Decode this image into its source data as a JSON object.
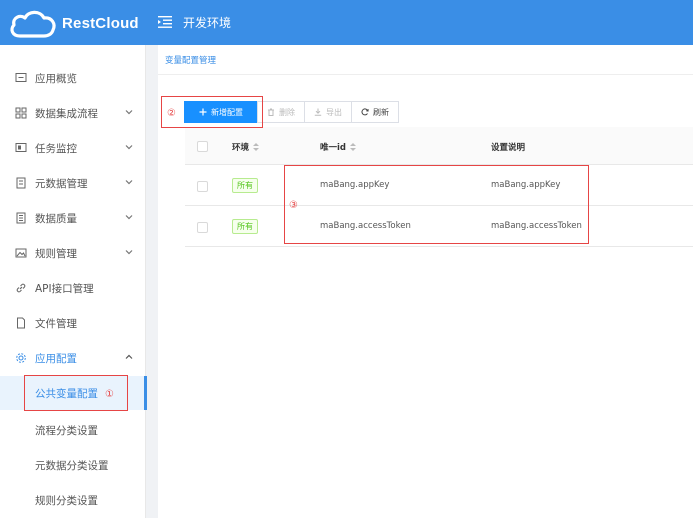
{
  "header": {
    "brand": "RestCloud",
    "env_title": "开发环境"
  },
  "sidebar": {
    "items": [
      {
        "label": "应用概览",
        "icon": "monitor-icon",
        "has_arrow": false
      },
      {
        "label": "数据集成流程",
        "icon": "grid-icon",
        "has_arrow": true
      },
      {
        "label": "任务监控",
        "icon": "screen-icon",
        "has_arrow": true
      },
      {
        "label": "元数据管理",
        "icon": "book-icon",
        "has_arrow": true
      },
      {
        "label": "数据质量",
        "icon": "list-icon",
        "has_arrow": true
      },
      {
        "label": "规则管理",
        "icon": "image-icon",
        "has_arrow": true
      },
      {
        "label": "API接口管理",
        "icon": "link-icon",
        "has_arrow": false
      },
      {
        "label": "文件管理",
        "icon": "file-icon",
        "has_arrow": false
      },
      {
        "label": "应用配置",
        "icon": "gear-icon",
        "has_arrow": true,
        "expanded": true
      }
    ],
    "sub_items": [
      {
        "label": "公共变量配置",
        "active": true
      },
      {
        "label": "流程分类设置"
      },
      {
        "label": "元数据分类设置"
      },
      {
        "label": "规则分类设置"
      }
    ]
  },
  "breadcrumb": "变量配置管理",
  "toolbar": {
    "add_label": "新增配置",
    "delete_label": "删除",
    "export_label": "导出",
    "refresh_label": "刷新"
  },
  "table": {
    "columns": [
      "环境",
      "唯一id",
      "设置说明"
    ],
    "rows": [
      {
        "env": "所有",
        "id": "maBang.appKey",
        "desc": "maBang.appKey"
      },
      {
        "env": "所有",
        "id": "maBang.accessToken",
        "desc": "maBang.accessToken"
      }
    ]
  },
  "annotations": [
    "①",
    "②",
    "③"
  ],
  "colors": {
    "accent": "#3a8ee6",
    "primary_button": "#1890ff",
    "tag_green": "#52c41a",
    "annotation_red": "#e64545"
  }
}
